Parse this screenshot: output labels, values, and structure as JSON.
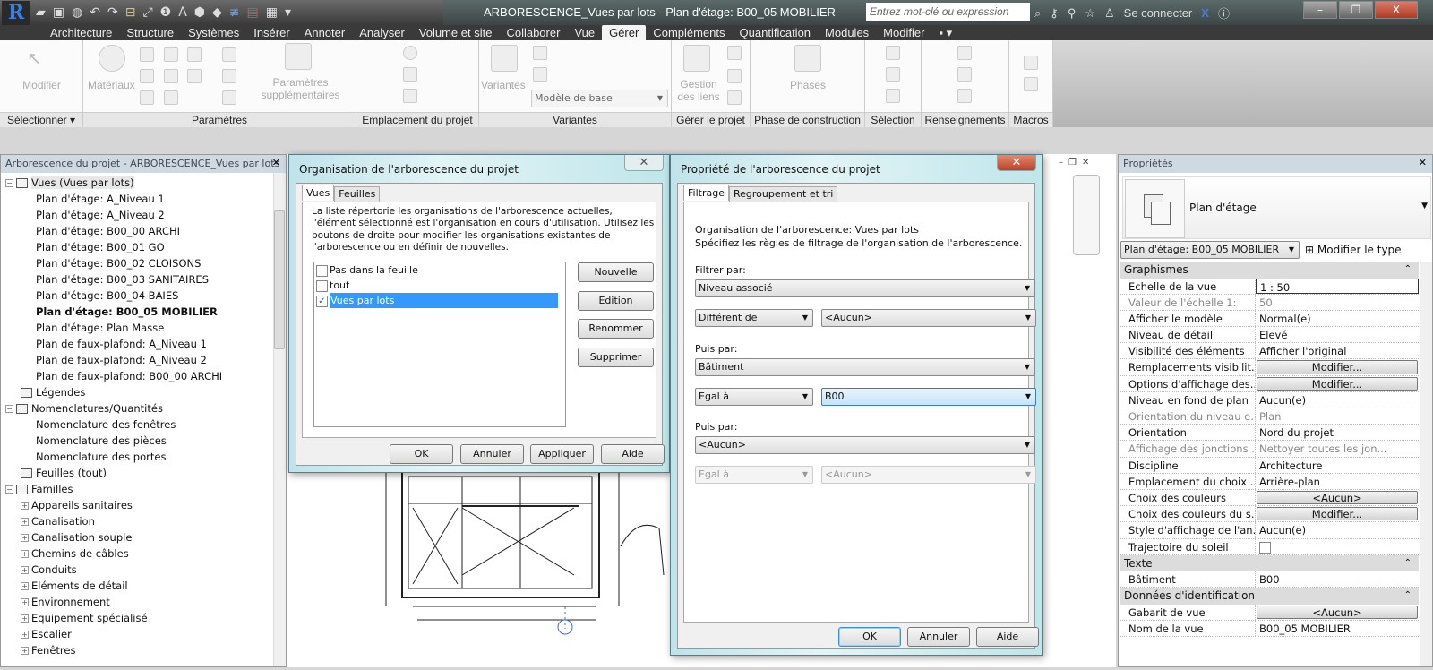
{
  "app": {
    "title": "ARBORESCENCE_Vues par lots - Plan d'étage: B00_05 MOBILIER",
    "search_placeholder": "Entrez mot-clé ou expression",
    "signin": "Se connecter",
    "logo": "R"
  },
  "ribbon": {
    "tabs": [
      "Architecture",
      "Structure",
      "Systèmes",
      "Insérer",
      "Annoter",
      "Analyser",
      "Volume et site",
      "Collaborer",
      "Vue",
      "Gérer",
      "Compléments",
      "Quantification",
      "Modules",
      "Modifier"
    ],
    "active_tab": "Gérer",
    "buttons": {
      "modifier": "Modifier",
      "materiaux": "Matériaux",
      "params_sup": "Paramètres supplémentaires",
      "variantes": "Variantes",
      "variante_select": "Modèle de base",
      "gestion_liens": "Gestion des liens",
      "phases": "Phases"
    },
    "panels": [
      "Sélectionner ▾",
      "Paramètres",
      "Emplacement du projet",
      "Variantes",
      "Gérer le projet",
      "Phase de construction",
      "Sélection",
      "Renseignements",
      "Macros"
    ]
  },
  "browser": {
    "title": "Arborescence du projet - ARBORESCENCE_Vues par lots",
    "root": "Vues (Vues par lots)",
    "views": [
      "Plan d'étage: A_Niveau 1",
      "Plan d'étage: A_Niveau 2",
      "Plan d'étage: B00_00 ARCHI",
      "Plan d'étage: B00_01 GO",
      "Plan d'étage: B00_02 CLOISONS",
      "Plan d'étage: B00_03 SANITAIRES",
      "Plan d'étage: B00_04 BAIES",
      "Plan d'étage: B00_05 MOBILIER",
      "Plan d'étage: Plan Masse",
      "Plan de faux-plafond: A_Niveau 1",
      "Plan de faux-plafond: A_Niveau 2",
      "Plan de faux-plafond: B00_00 ARCHI"
    ],
    "legendes": "Légendes",
    "nomenclatures": "Nomenclatures/Quantités",
    "nomenclature_items": [
      "Nomenclature des fenêtres",
      "Nomenclature des pièces",
      "Nomenclature des portes"
    ],
    "feuilles": "Feuilles (tout)",
    "familles": "Familles",
    "famille_items": [
      "Appareils sanitaires",
      "Canalisation",
      "Canalisation souple",
      "Chemins de câbles",
      "Conduits",
      "Eléments de détail",
      "Environnement",
      "Equipement spécialisé",
      "Escalier",
      "Fenêtres"
    ]
  },
  "dialog1": {
    "title": "Organisation de l'arborescence du projet",
    "tabs": [
      "Vues",
      "Feuilles"
    ],
    "description": "La liste répertorie les organisations de l'arborescence actuelles, l'élément sélectionné est l'organisation en cours d'utilisation. Utilisez les boutons de droite pour modifier les organisations existantes de l'arborescence ou en définir de nouvelles.",
    "items": [
      {
        "label": "Pas dans la feuille",
        "checked": false
      },
      {
        "label": "tout",
        "checked": false
      },
      {
        "label": "Vues par lots",
        "checked": true
      }
    ],
    "side_buttons": [
      "Nouvelle",
      "Edition",
      "Renommer",
      "Supprimer"
    ],
    "bottom_buttons": [
      "OK",
      "Annuler",
      "Appliquer",
      "Aide"
    ]
  },
  "dialog2": {
    "title": "Propriété de l'arborescence du projet",
    "tabs": [
      "Filtrage",
      "Regroupement et tri"
    ],
    "org_line": "Organisation de l'arborescence: Vues par lots",
    "spec_line": "Spécifiez les règles de filtrage de l'organisation de l'arborescence.",
    "filter_label": "Filtrer par:",
    "filter1": {
      "field": "Niveau associé",
      "op": "Différent de",
      "value": "<Aucun>"
    },
    "then_label": "Puis par:",
    "filter2": {
      "field": "Bâtiment",
      "op": "Egal à",
      "value": "B00"
    },
    "filter3": {
      "field": "<Aucun>",
      "op": "Egal à",
      "value": "<Aucun>"
    },
    "buttons": [
      "OK",
      "Annuler",
      "Aide"
    ]
  },
  "properties": {
    "title": "Propriétés",
    "type_name": "Plan d'étage",
    "instance_select": "Plan d'étage: B00_05 MOBILIER",
    "edit_type": "Modifier le type",
    "groups": [
      {
        "name": "Graphismes",
        "rows": [
          {
            "k": "Echelle de la vue",
            "v": "1 : 50",
            "kind": "input"
          },
          {
            "k": "Valeur de l'échelle    1:",
            "v": "50",
            "dim": true
          },
          {
            "k": "Afficher le modèle",
            "v": "Normal(e)"
          },
          {
            "k": "Niveau de détail",
            "v": "Elevé"
          },
          {
            "k": "Visibilité des éléments",
            "v": "Afficher l'original"
          },
          {
            "k": "Remplacements visibilit...",
            "v": "Modifier...",
            "kind": "button"
          },
          {
            "k": "Options d'affichage des...",
            "v": "Modifier...",
            "kind": "button"
          },
          {
            "k": "Niveau en fond de plan",
            "v": "Aucun(e)"
          },
          {
            "k": "Orientation du niveau e...",
            "v": "Plan",
            "dim": true
          },
          {
            "k": "Orientation",
            "v": "Nord du projet"
          },
          {
            "k": "Affichage des jonctions ...",
            "v": "Nettoyer toutes les jon...",
            "dim": true
          },
          {
            "k": "Discipline",
            "v": "Architecture"
          },
          {
            "k": "Emplacement du choix ...",
            "v": "Arrière-plan"
          },
          {
            "k": "Choix des couleurs",
            "v": "<Aucun>",
            "kind": "button"
          },
          {
            "k": "Choix des couleurs du s...",
            "v": "Modifier...",
            "kind": "button"
          },
          {
            "k": "Style d'affichage de l'an...",
            "v": "Aucun(e)"
          },
          {
            "k": "Trajectoire du soleil",
            "v": "",
            "kind": "checkbox"
          }
        ]
      },
      {
        "name": "Texte",
        "rows": [
          {
            "k": "Bâtiment",
            "v": "B00"
          }
        ]
      },
      {
        "name": "Données d'identification",
        "rows": [
          {
            "k": "Gabarit de vue",
            "v": "<Aucun>",
            "kind": "button"
          },
          {
            "k": "Nom de la vue",
            "v": "B00_05 MOBILIER"
          }
        ]
      }
    ]
  },
  "colors": {
    "selection": "#3399ff",
    "titlebar": "#3c4646"
  }
}
